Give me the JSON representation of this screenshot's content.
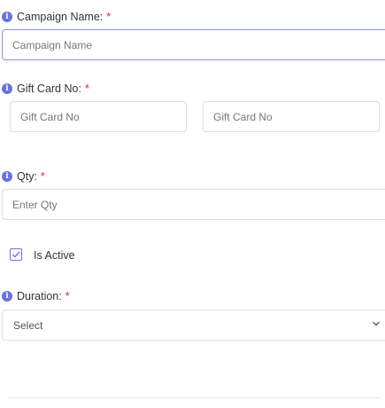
{
  "form": {
    "campaign_name": {
      "label": "Campaign Name:",
      "required_mark": "*",
      "placeholder": "Campaign Name",
      "value": ""
    },
    "gift_card_no": {
      "label": "Gift Card No:",
      "required_mark": "*",
      "placeholder_from": "Gift Card No",
      "placeholder_to": "Gift Card No"
    },
    "qty": {
      "label": "Qty:",
      "required_mark": "*",
      "placeholder": "Enter Qty",
      "value": ""
    },
    "is_active": {
      "label": "Is Active",
      "checked": true
    },
    "duration": {
      "label": "Duration:",
      "required_mark": "*",
      "selected": "Select"
    },
    "info_icon_glyph": "i"
  },
  "colors": {
    "accent": "#6672e6",
    "required": "#e0291c",
    "border": "#dcdfe6"
  }
}
